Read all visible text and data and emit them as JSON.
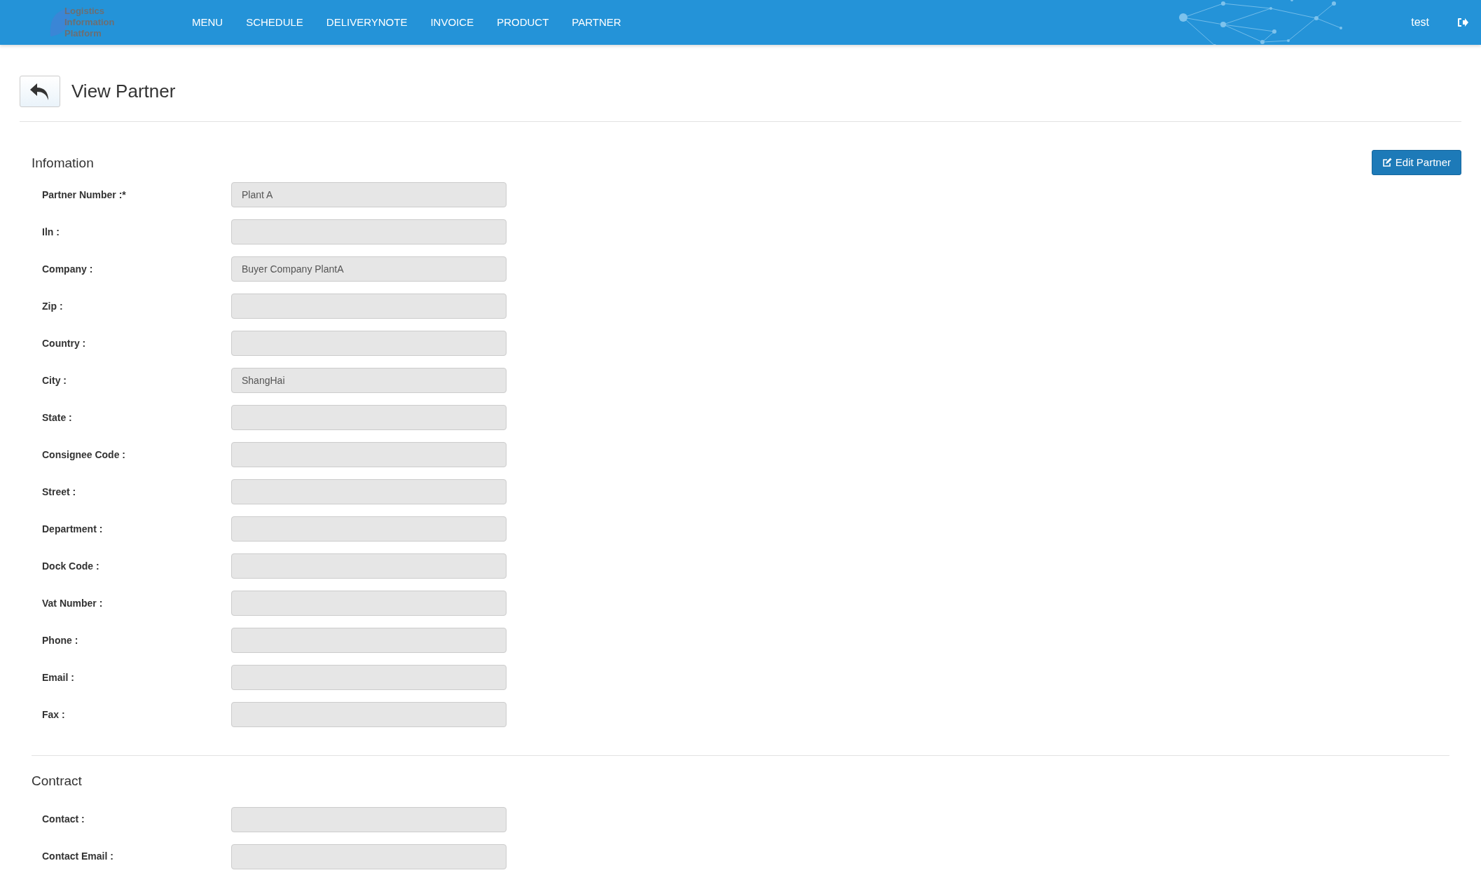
{
  "header": {
    "logo_lines": [
      "Logistics",
      "Information",
      "Platform"
    ],
    "nav": [
      {
        "label": "MENU",
        "selected": false
      },
      {
        "label": "SCHEDULE",
        "selected": false
      },
      {
        "label": "DELIVERYNOTE",
        "selected": false
      },
      {
        "label": "INVOICE",
        "selected": false
      },
      {
        "label": "PRODUCT",
        "selected": false
      },
      {
        "label": "PARTNER",
        "selected": false
      }
    ],
    "user": "test"
  },
  "page": {
    "title": "View Partner"
  },
  "sections": [
    {
      "title": "Infomation",
      "button": "Edit Partner",
      "fields": [
        {
          "label": "Partner Number :*",
          "value": "Plant A",
          "disabled": true
        },
        {
          "label": "Iln :",
          "disabled": true
        },
        {
          "label": "Company :",
          "value": "Buyer Company PlantA",
          "disabled": true
        },
        {
          "label": "Zip :",
          "disabled": true
        },
        {
          "label": "Country :",
          "disabled": true
        },
        {
          "label": "City :",
          "value": "ShangHai",
          "disabled": true
        },
        {
          "label": "State :",
          "disabled": true
        },
        {
          "label": "Consignee Code :",
          "disabled": true
        },
        {
          "label": "Street :",
          "disabled": true
        },
        {
          "label": "Department :",
          "disabled": true
        },
        {
          "label": "Dock Code :",
          "disabled": true
        },
        {
          "label": "Vat Number :",
          "disabled": true
        },
        {
          "label": "Phone :",
          "disabled": true
        },
        {
          "label": "Email :",
          "disabled": true
        },
        {
          "label": "Fax :",
          "disabled": true
        }
      ]
    },
    {
      "title": "Contract",
      "fields": [
        {
          "label": "Contact :",
          "disabled": true
        },
        {
          "label": "Contact Email :",
          "disabled": true
        }
      ]
    }
  ]
}
